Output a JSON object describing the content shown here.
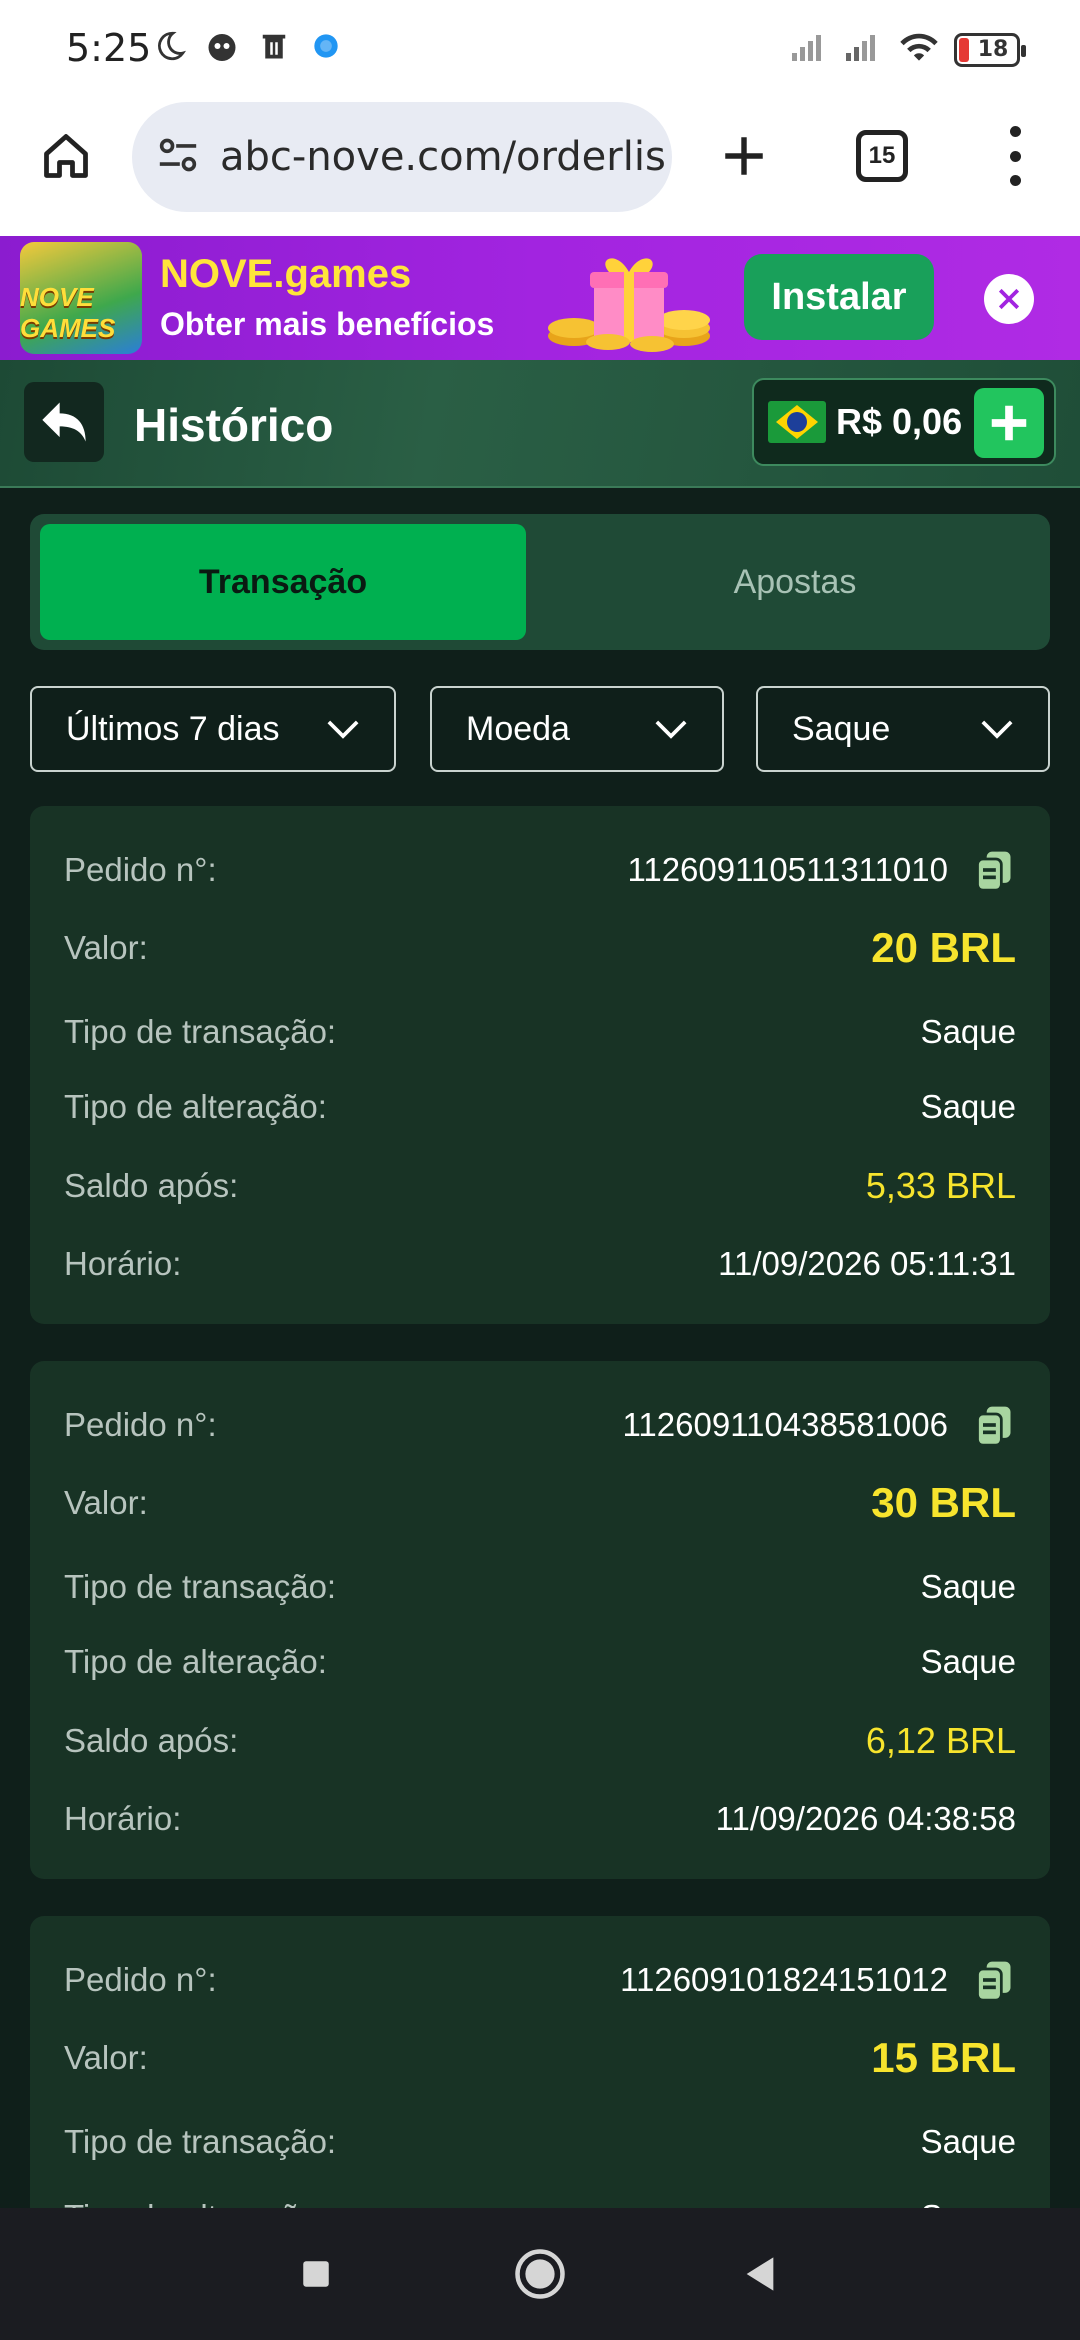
{
  "status_bar": {
    "time": "5:25",
    "battery": "18"
  },
  "browser": {
    "url": "abc-nove.com/orderlis",
    "tab_count": "15"
  },
  "banner": {
    "logo_text": "NOVE GAMES",
    "title": "NOVE.games",
    "subtitle": "Obter mais benefícios",
    "install_label": "Instalar"
  },
  "header": {
    "title": "Histórico",
    "balance": "R$ 0,06"
  },
  "tabs": [
    {
      "label": "Transação",
      "active": true
    },
    {
      "label": "Apostas",
      "active": false
    }
  ],
  "filters": {
    "period": "Últimos 7 dias",
    "currency": "Moeda",
    "type": "Saque"
  },
  "labels": {
    "order": "Pedido n°:",
    "amount": "Valor:",
    "transaction_type": "Tipo de transação:",
    "change_type": "Tipo de alteração:",
    "balance_after": "Saldo após:",
    "time": "Horário:"
  },
  "transactions": [
    {
      "order_no": "112609110511311010",
      "amount": "20 BRL",
      "transaction_type": "Saque",
      "change_type": "Saque",
      "balance_after": "5,33 BRL",
      "time": "11/09/2026 05:11:31"
    },
    {
      "order_no": "112609110438581006",
      "amount": "30 BRL",
      "transaction_type": "Saque",
      "change_type": "Saque",
      "balance_after": "6,12 BRL",
      "time": "11/09/2026 04:38:58"
    },
    {
      "order_no": "112609101824151012",
      "amount": "15 BRL",
      "transaction_type": "Saque",
      "change_type": "Saque",
      "balance_after": "",
      "time": ""
    }
  ],
  "colors": {
    "accent_green": "#00b050",
    "amount_yellow": "#f7e42d",
    "card_bg": "#183325",
    "banner_purple": "#a224e0"
  }
}
